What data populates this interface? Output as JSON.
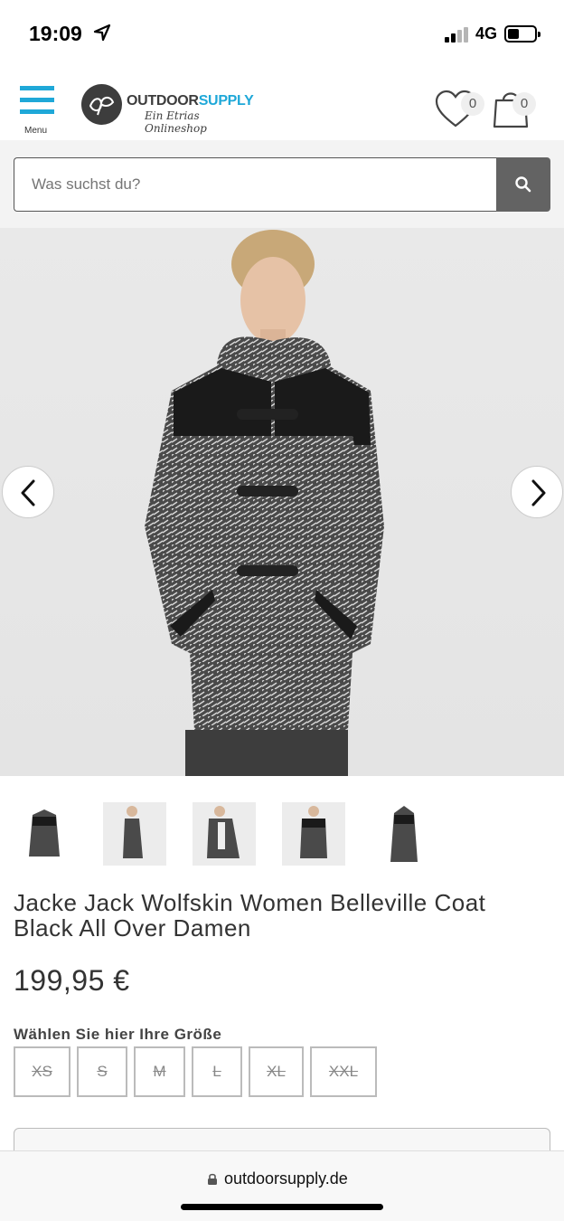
{
  "status": {
    "time": "19:09",
    "network": "4G"
  },
  "header": {
    "menu_label": "Menu",
    "logo_part1": "OUTDOOR",
    "logo_part2": "SUPPLY",
    "logo_tagline": "Ein Etrias Onlineshop",
    "wishlist_count": "0",
    "cart_count": "0",
    "brand_color": "#1fa8d8"
  },
  "search": {
    "placeholder": "Was suchst du?",
    "icon": "search-icon"
  },
  "gallery": {
    "prev_icon": "chevron-left-icon",
    "next_icon": "chevron-right-icon",
    "thumbnail_count": 5
  },
  "product": {
    "title": "Jacke Jack Wolfskin Women Belleville Coat Black All Over Damen",
    "price": "199,95 €",
    "size_label": "Wählen Sie hier Ihre Größe",
    "sizes": [
      "XS",
      "S",
      "M",
      "L",
      "XL",
      "XXL"
    ]
  },
  "browser": {
    "url": "outdoorsupply.de"
  }
}
